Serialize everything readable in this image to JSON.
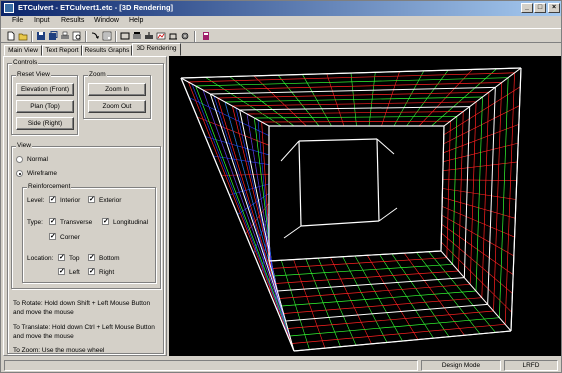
{
  "window": {
    "title": "ETCulvert - ETCulvert1.etc - [3D Rendering]"
  },
  "menu": [
    "File",
    "Input",
    "Results",
    "Window",
    "Help"
  ],
  "tabs": [
    "Main View",
    "Text Report",
    "Results Graphs",
    "3D Rendering"
  ],
  "controls": {
    "title": "Controls",
    "reset_view": {
      "title": "Reset View",
      "elevation": "Elevation (Front)",
      "plan": "Plan (Top)",
      "side": "Side (Right)"
    },
    "zoom": {
      "title": "Zoom",
      "zoom_in": "Zoom In",
      "zoom_out": "Zoom Out"
    },
    "view": {
      "title": "View",
      "normal": "Normal",
      "wireframe": "Wireframe",
      "reinforcement": {
        "title": "Reinforcement",
        "level": "Level:",
        "interior": "Interior",
        "exterior": "Exterior",
        "type": "Type:",
        "transverse": "Transverse",
        "longitudinal": "Longitudinal",
        "corner": "Corner",
        "location": "Location:",
        "top": "Top",
        "bottom": "Bottom",
        "left": "Left",
        "right": "Right"
      }
    },
    "help": {
      "rotate_1": "To Rotate: Hold down Shift + Left Mouse Button",
      "rotate_2": "and move the mouse",
      "translate_1": "To Translate: Hold down Ctrl + Left Mouse Button",
      "translate_2": "and move the mouse",
      "zoom": "To Zoom: Use the mouse wheel"
    }
  },
  "status": {
    "mode": "Design Mode",
    "units": "LRFD"
  },
  "colors": {
    "viewport_bg": "#000000",
    "white_wire": "#ffffff",
    "green_rebar": "#33ff33",
    "red_rebar": "#ff2020",
    "blue_rebar": "#2040ff"
  }
}
